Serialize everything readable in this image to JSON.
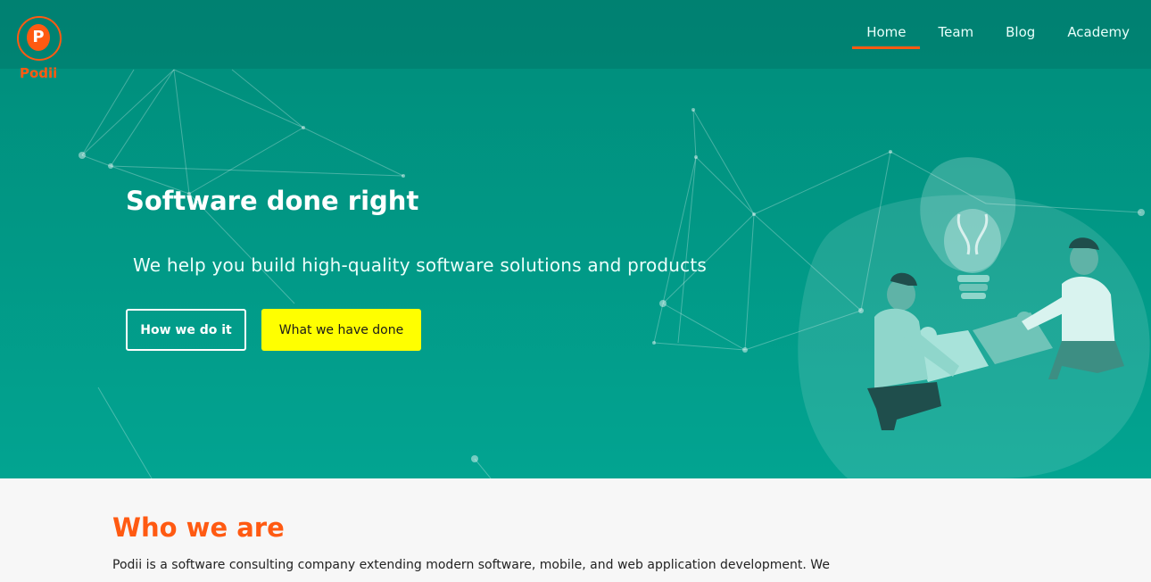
{
  "brand": {
    "name": "Podii",
    "logo_letter": "P",
    "accent_color": "#ff5a12"
  },
  "nav": {
    "items": [
      {
        "label": "Home",
        "active": true
      },
      {
        "label": "Team",
        "active": false
      },
      {
        "label": "Blog",
        "active": false
      },
      {
        "label": "Academy",
        "active": false
      }
    ]
  },
  "hero": {
    "title": "Software done right",
    "subtitle": "We help you build high-quality software solutions and products",
    "primary_button": "How we do it",
    "secondary_button": "What we have done",
    "background_color": "#019786",
    "illustration": "team-puzzle-lightbulb-illustration"
  },
  "about": {
    "title": "Who we are",
    "text": "Podii is a software consulting company extending modern software, mobile, and web application development. We"
  }
}
